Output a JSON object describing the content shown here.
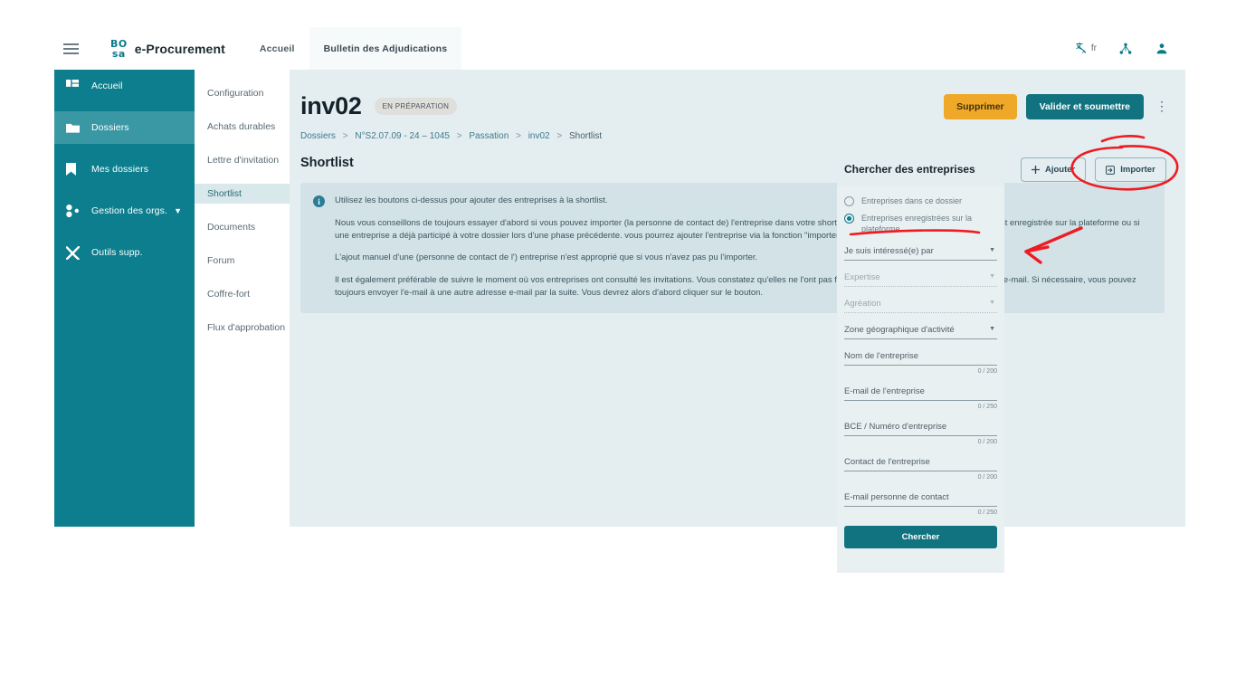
{
  "topbar": {
    "menu_icon": "hamburger-icon",
    "logo_line1": "BO",
    "logo_line2": "sa",
    "brand": "e-Procurement",
    "nav": [
      {
        "label": "Accueil",
        "boxed": false
      },
      {
        "label": "Bulletin des Adjudications",
        "boxed": true
      }
    ],
    "lang_label": "fr",
    "lang_icon": "translate-icon",
    "org_icon": "organization-tree-icon",
    "account_icon": "user-avatar-icon"
  },
  "sidebar": {
    "items": [
      {
        "label": "Accueil",
        "icon": "dashboard-icon",
        "active": false,
        "chevron": false
      },
      {
        "label": "Dossiers",
        "icon": "folder-icon",
        "active": true,
        "chevron": false
      },
      {
        "label": "Mes dossiers",
        "icon": "bookmark-icon",
        "active": false,
        "chevron": false
      },
      {
        "label": "Gestion des orgs.",
        "icon": "organization-icon",
        "active": false,
        "chevron": true
      },
      {
        "label": "Outils supp.",
        "icon": "tools-icon",
        "active": false,
        "chevron": false
      }
    ]
  },
  "subnav": {
    "items": [
      {
        "label": "Configuration",
        "active": false
      },
      {
        "label": "Achats durables",
        "active": false
      },
      {
        "label": "Lettre d'invitation",
        "active": false
      },
      {
        "label": "Shortlist",
        "active": true
      },
      {
        "label": "Documents",
        "active": false
      },
      {
        "label": "Forum",
        "active": false
      },
      {
        "label": "Coffre-fort",
        "active": false
      },
      {
        "label": "Flux d'approbation",
        "active": false
      }
    ]
  },
  "header": {
    "title": "inv02",
    "status": "EN PRÉPARATION",
    "delete_label": "Supprimer",
    "submit_label": "Valider et soumettre",
    "kebab_icon": "more-vertical-icon"
  },
  "breadcrumb": {
    "items": [
      "Dossiers",
      "N°S2.07.09 - 24 – 1045",
      "Passation",
      "inv02",
      "Shortlist"
    ],
    "separator": ">"
  },
  "main": {
    "section_title": "Shortlist",
    "info_icon": "info-icon",
    "info_paragraphs": [
      "Utilisez les boutons ci-dessus pour ajouter des entreprises à la shortlist.",
      "Nous vous conseillons de toujours essayer d'abord si vous pouvez importer (la personne de contact de) l'entreprise dans votre shortlist. Cela n'est possible que si l'entreprise est enregistrée sur la plateforme ou si une entreprise a déjà participé à votre dossier lors d'une phase précédente. vous pourrez ajouter l'entreprise via la fonction \"importer\".",
      "L'ajout manuel d'une (personne de contact de l') entreprise n'est approprié que si vous n'avez pas pu l'importer.",
      "Il est également préférable de suivre le moment où vos entreprises ont consulté les invitations. Vous constatez qu'elles ne l'ont pas fait ? Demandez-leur alors si elles ont reçu l'e-mail. Si nécessaire, vous pouvez toujours envoyer l'e-mail à une autre adresse e-mail par la suite. Vous devrez alors d'abord cliquer sur le bouton."
    ]
  },
  "search_panel": {
    "title": "Chercher des entreprises",
    "add_label": "Ajouter",
    "add_icon": "plus-icon",
    "import_label": "Importer",
    "import_icon": "import-icon",
    "radios": [
      {
        "label": "Entreprises dans ce dossier",
        "checked": false
      },
      {
        "label": "Entreprises enregistrées sur la plateforme",
        "checked": true
      }
    ],
    "selects": [
      {
        "label": "Je suis intéressé(e) par",
        "disabled": false,
        "caret": "chevron-down-icon"
      },
      {
        "label": "Expertise",
        "disabled": true,
        "caret": "chevron-down-icon"
      },
      {
        "label": "Agréation",
        "disabled": true,
        "caret": "chevron-down-icon"
      },
      {
        "label": "Zone géographique d'activité",
        "disabled": false,
        "caret": "chevron-down-icon"
      }
    ],
    "inputs": [
      {
        "label": "Nom de l'entreprise",
        "counter": "0 / 200"
      },
      {
        "label": "E-mail de l'entreprise",
        "counter": "0 / 250"
      },
      {
        "label": "BCE / Numéro d'entreprise",
        "counter": "0 / 200"
      },
      {
        "label": "Contact de l'entreprise",
        "counter": "0 / 200"
      },
      {
        "label": "E-mail personne de contact",
        "counter": "0 / 250"
      }
    ],
    "search_label": "Chercher"
  },
  "annotations": {
    "circle_target": "import-button",
    "arrow_target": "platform-companies-radio",
    "underline_target": "platform-companies-radio",
    "color": "#ee1c22"
  },
  "colors": {
    "sidebar": "#0c7e8d",
    "sidebar_active": "#3a98a4",
    "main_bg": "#e4edf0",
    "info_bg": "#d2e2e7",
    "teal": "#11737f",
    "orange": "#f0a828",
    "annotation_red": "#ee1c22"
  }
}
